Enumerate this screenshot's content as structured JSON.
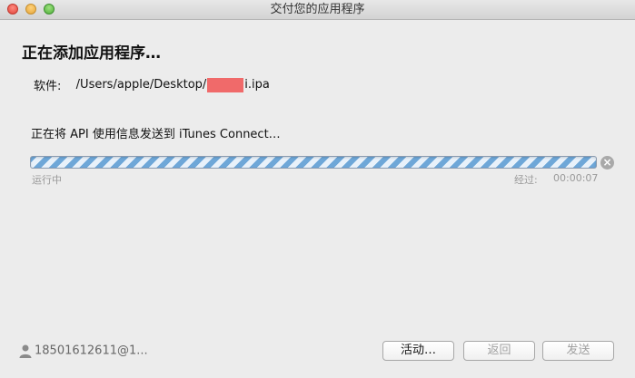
{
  "window": {
    "title": "交付您的应用程序"
  },
  "main": {
    "heading": "正在添加应用程序…",
    "software_label": "软件:",
    "software_path_prefix": "/Users/apple/Desktop/",
    "software_path_suffix": "i.ipa",
    "status_text": "正在将 API 使用信息发送到 iTunes Connect…",
    "progress_state": "indeterminate",
    "running_label": "运行中",
    "elapsed_label": "经过:",
    "elapsed_value": "00:00:07"
  },
  "footer": {
    "account": "18501612611@1...",
    "activity_button": "活动…",
    "back_button": "返回",
    "send_button": "发送"
  },
  "icons": {
    "cancel": "close-circle-icon",
    "user": "user-icon"
  }
}
